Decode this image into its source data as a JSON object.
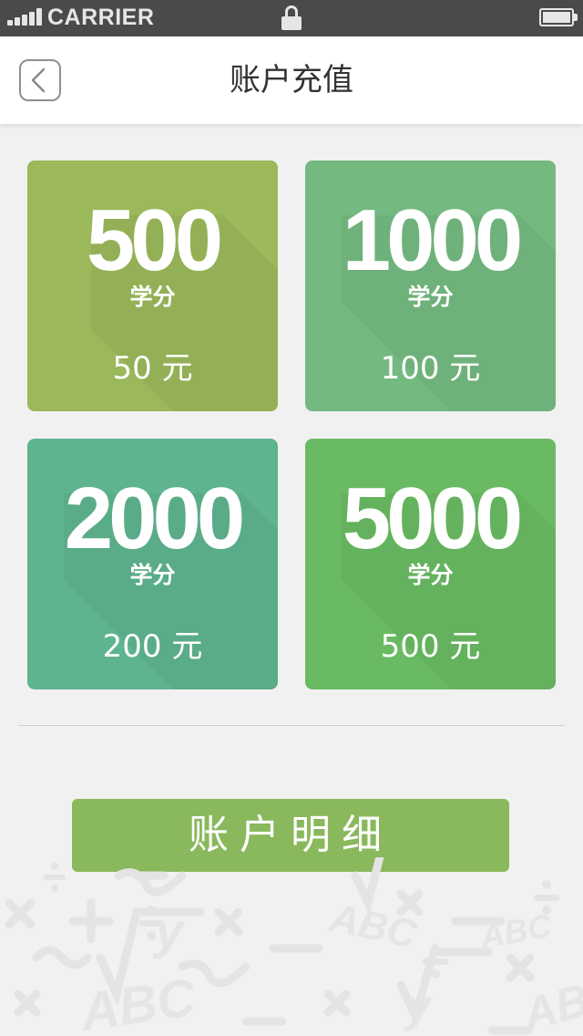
{
  "status_bar": {
    "carrier": "CARRIER",
    "icons": [
      "signal-icon",
      "lock-icon",
      "battery-icon"
    ]
  },
  "nav": {
    "back_icon": "chevron-left-icon",
    "title": "账户充值"
  },
  "cards": [
    {
      "points": "500",
      "unit": "学分",
      "price": "50 元",
      "color": "#9bb85a"
    },
    {
      "points": "1000",
      "unit": "学分",
      "price": "100 元",
      "color": "#74b980"
    },
    {
      "points": "2000",
      "unit": "学分",
      "price": "200 元",
      "color": "#5db48e"
    },
    {
      "points": "5000",
      "unit": "学分",
      "price": "500 元",
      "color": "#6aba63"
    }
  ],
  "detail_button": {
    "label": "账户明细",
    "color": "#8ab85c"
  },
  "colors": {
    "status_bar_bg": "#4a4a4a",
    "page_bg": "#f1f1f1",
    "nav_bg": "#ffffff"
  },
  "background_pattern": {
    "icons": [
      "math-symbols-pattern"
    ],
    "motif": "ABC"
  }
}
